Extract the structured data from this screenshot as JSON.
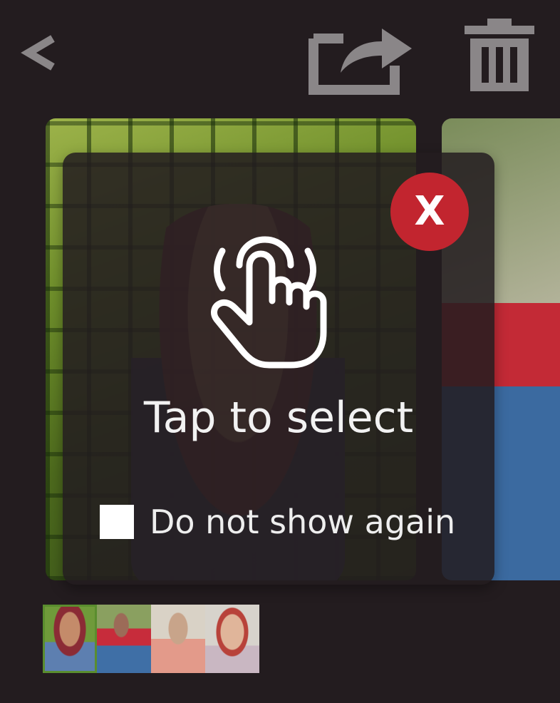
{
  "header": {
    "back_icon": "chevron-left-icon",
    "share_icon": "share-icon",
    "delete_icon": "trash-icon"
  },
  "colors": {
    "background": "#231c1f",
    "icon_gray": "#8a8688",
    "close_red": "#c2252f",
    "text": "#f2f2f2"
  },
  "overlay": {
    "close_label": "X",
    "hand_icon": "tap-hand-icon",
    "title": "Tap to select",
    "checkbox_checked": false,
    "checkbox_label": "Do not show again"
  },
  "thumbnails": [
    {
      "active": true
    },
    {
      "active": false
    },
    {
      "active": false
    },
    {
      "active": false
    }
  ]
}
